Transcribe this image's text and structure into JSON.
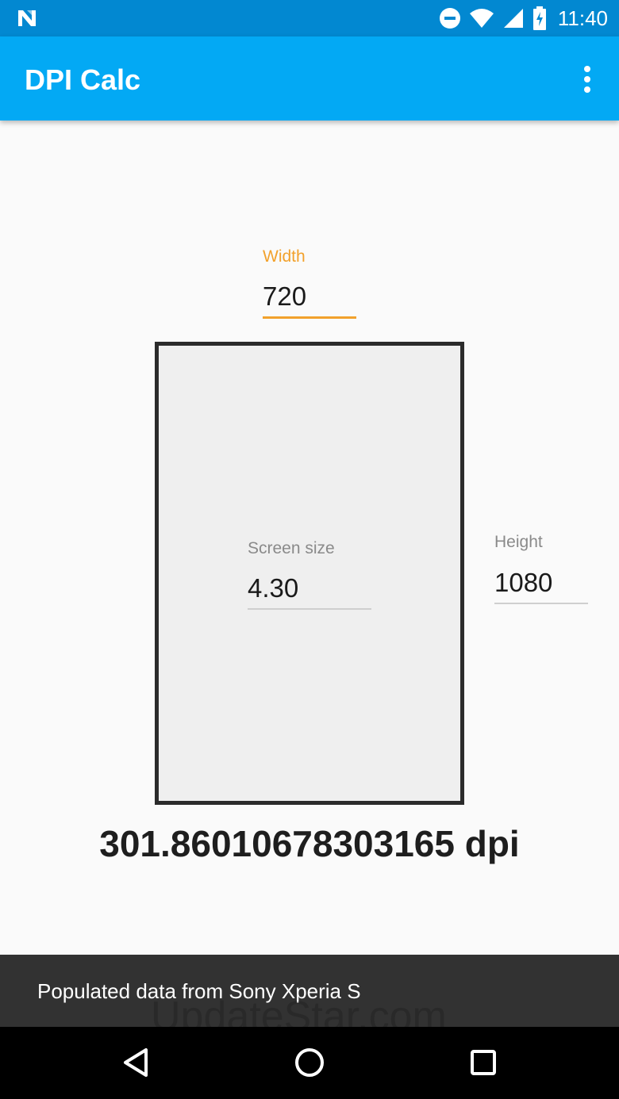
{
  "status_bar": {
    "time": "11:40",
    "icons": [
      "notification-n-icon",
      "dnd-icon",
      "wifi-icon",
      "signal-icon",
      "battery-charging-icon"
    ]
  },
  "app_bar": {
    "title": "DPI Calc",
    "overflow_icon": "more-vert-icon"
  },
  "width_field": {
    "label": "Width",
    "value": "720"
  },
  "screen_size_field": {
    "label": "Screen size",
    "value": "4.30"
  },
  "height_field": {
    "label": "Height",
    "value": "1080"
  },
  "result": {
    "text": "301.86010678303165 dpi"
  },
  "snackbar": {
    "message": "Populated data from Sony Xperia S"
  },
  "watermark": {
    "text": "UpdateStar.com"
  },
  "nav_bar": {
    "icons": [
      "back-icon",
      "home-icon",
      "recents-icon"
    ]
  },
  "colors": {
    "status_bar": "#0288d1",
    "app_bar": "#03a9f4",
    "accent": "#f2a12c",
    "snackbar": "#323232",
    "nav_bar": "#000000"
  }
}
